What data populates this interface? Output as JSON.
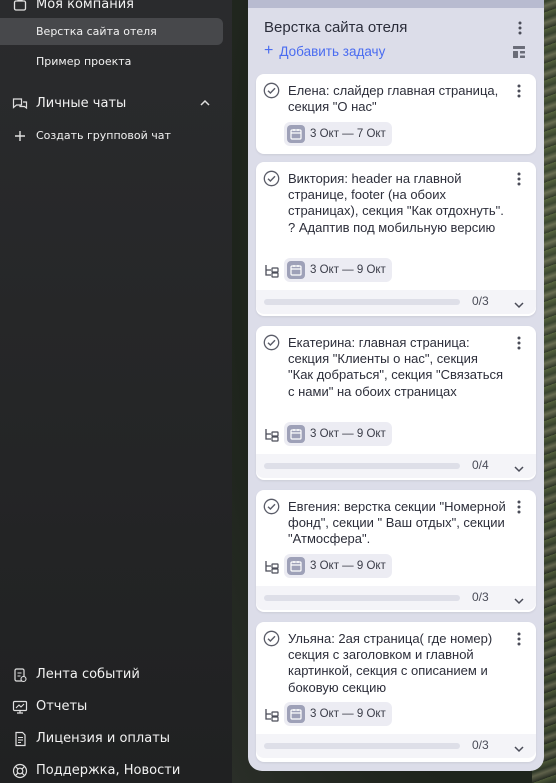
{
  "sidebar": {
    "company": "Моя компания",
    "projects": [
      {
        "label": "Верстка сайта отеля",
        "active": true
      },
      {
        "label": "Пример проекта",
        "active": false
      }
    ],
    "chats_label": "Личные чаты",
    "create_group": "Создать групповой чат",
    "bottom": [
      {
        "label": "Лента событий",
        "icon": "feed-icon"
      },
      {
        "label": "Отчеты",
        "icon": "reports-icon"
      },
      {
        "label": "Лицензия и оплаты",
        "icon": "license-icon"
      },
      {
        "label": "Поддержка, Новости",
        "icon": "support-icon"
      }
    ]
  },
  "column": {
    "title": "Верстка сайта отеля",
    "add_task": "Добавить задачу",
    "cards": [
      {
        "text": "Елена: слайдер главная страница, секция \"О нас\"",
        "date": "3 Окт — 7 Окт",
        "has_subtasks": false
      },
      {
        "text": "Виктория: header на главной странице, footer (на обоих страницах), секция \"Как отдохнуть\". ? Адаптив под мобильную версию",
        "date": "3 Окт — 9 Окт",
        "has_subtasks": true,
        "progress": "0/3",
        "progress_fraction": 0
      },
      {
        "text": "Екатерина: главная страница: секция \"Клиенты о нас\", секция \"Как добраться\", секция \"Связаться с нами\" на обоих страницах",
        "date": "3 Окт — 9 Окт",
        "has_subtasks": true,
        "progress": "0/4",
        "progress_fraction": 0
      },
      {
        "text": "Евгения: верстка секции \"Номерной фонд\", секции \" Ваш отдых\", секции \"Атмосфера\".",
        "date": "3 Окт — 9 Окт",
        "has_subtasks": true,
        "progress": "0/3",
        "progress_fraction": 0
      },
      {
        "text": "Ульяна: 2ая страница( где номер) секция с заголовком и главной картинкой, секция с описанием и боковую секцию",
        "date": "3 Окт — 9 Окт",
        "has_subtasks": true,
        "progress": "0/3",
        "progress_fraction": 0
      }
    ]
  },
  "colors": {
    "accent": "#4a6cf0",
    "sidebar_bg": "#252628",
    "column_bg": "#dcdde9",
    "card_bg": "#ffffff"
  }
}
